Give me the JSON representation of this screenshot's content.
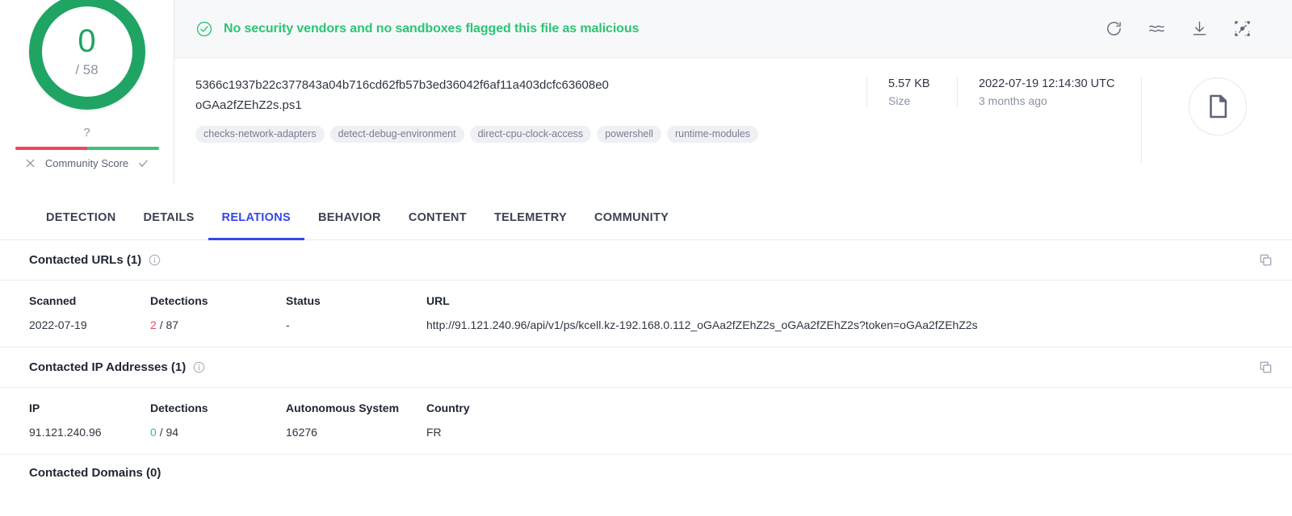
{
  "gauge": {
    "score": "0",
    "total": "/ 58",
    "question_mark": "?",
    "community_label": "Community Score",
    "negative_pct": 50,
    "positive_pct": 50,
    "ring_color": "#1fa463",
    "score_color": "#1fa463",
    "negative_color": "#f0435a",
    "positive_color": "#3ac279"
  },
  "verdict": {
    "text": "No security vendors and no sandboxes flagged this file as malicious",
    "color": "#2cc474",
    "icon": "check-circle-icon"
  },
  "banner_actions": [
    {
      "name": "reload-icon",
      "title": "Reanalyse"
    },
    {
      "name": "similar-icon",
      "title": "Similar"
    },
    {
      "name": "download-icon",
      "title": "Download"
    },
    {
      "name": "vt-graph-icon",
      "title": "VT Graph"
    }
  ],
  "file": {
    "hash": "5366c1937b22c377843a04b716cd62fb57b3ed36042f6af11a403dcfc63608e0",
    "name": "oGAa2fZEhZ2s.ps1",
    "tags": [
      "checks-network-adapters",
      "detect-debug-environment",
      "direct-cpu-clock-access",
      "powershell",
      "runtime-modules"
    ],
    "size_value": "5.57 KB",
    "size_label": "Size",
    "date_value": "2022-07-19 12:14:30 UTC",
    "date_label": "3 months ago",
    "type_icon": "document-icon"
  },
  "tabs": [
    {
      "label": "DETECTION",
      "active": false
    },
    {
      "label": "DETAILS",
      "active": false
    },
    {
      "label": "RELATIONS",
      "active": true
    },
    {
      "label": "BEHAVIOR",
      "active": false
    },
    {
      "label": "CONTENT",
      "active": false
    },
    {
      "label": "TELEMETRY",
      "active": false
    },
    {
      "label": "COMMUNITY",
      "active": false
    }
  ],
  "contacted_urls": {
    "title": "Contacted URLs (1)",
    "headers": [
      "Scanned",
      "Detections",
      "Status",
      "URL"
    ],
    "rows": [
      {
        "scanned": "2022-07-19",
        "detections_hits": "2",
        "detections_total": "/ 87",
        "detections_state": "bad",
        "status": "-",
        "url": "http://91.121.240.96/api/v1/ps/kcell.kz-192.168.0.112_oGAa2fZEhZ2s_oGAa2fZEhZ2s?token=oGAa2fZEhZ2s"
      }
    ]
  },
  "contacted_ips": {
    "title": "Contacted IP Addresses (1)",
    "headers": [
      "IP",
      "Detections",
      "Autonomous System",
      "Country"
    ],
    "rows": [
      {
        "ip": "91.121.240.96",
        "detections_hits": "0",
        "detections_total": "/ 94",
        "detections_state": "good",
        "autonomous_system": "16276",
        "country": "FR"
      }
    ]
  },
  "next_section": {
    "title": "Contacted Domains (0)"
  }
}
